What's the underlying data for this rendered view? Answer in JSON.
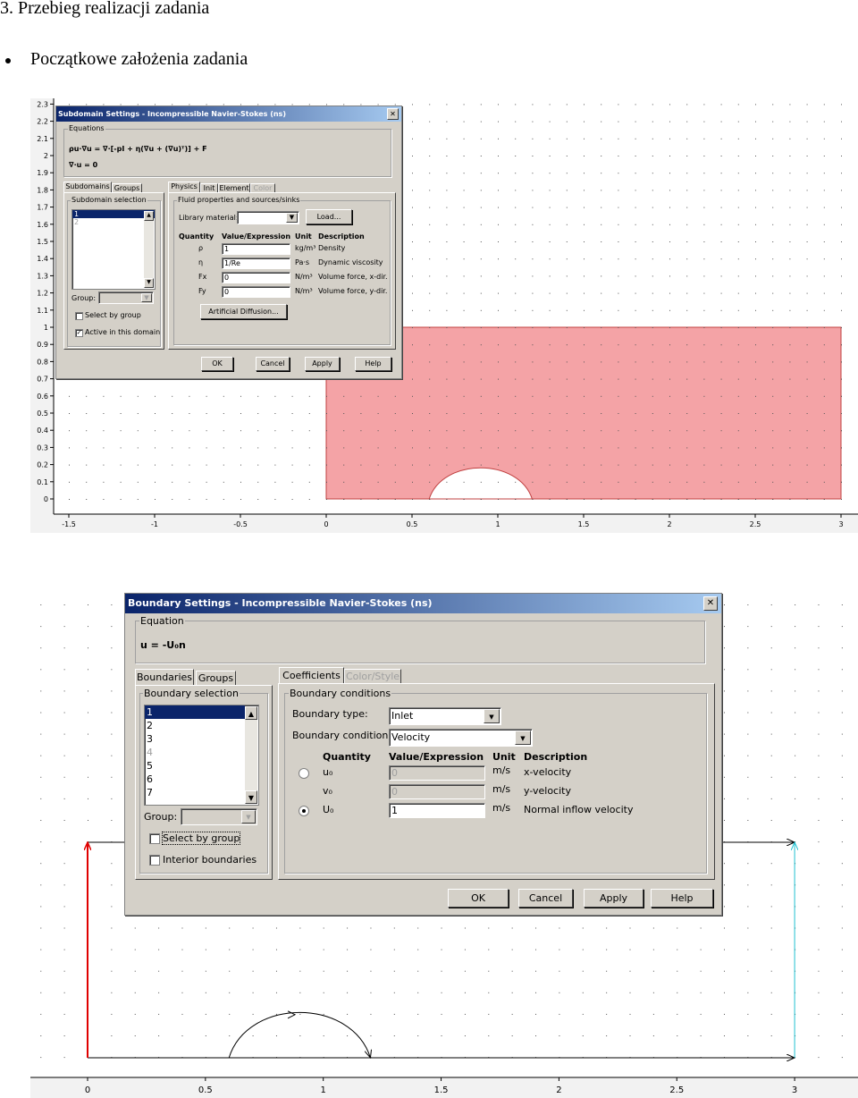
{
  "document": {
    "heading": "3.  Przebieg realizacji zadania",
    "bullet": "Początkowe założenia zadania"
  },
  "figure1": {
    "y_ticks": [
      "0",
      "0.1",
      "0.2",
      "0.3",
      "0.4",
      "0.5",
      "0.6",
      "0.7",
      "0.8",
      "0.9",
      "1",
      "1.1",
      "1.2",
      "1.3",
      "1.4",
      "1.5",
      "1.6",
      "1.7",
      "1.8",
      "1.9",
      "2",
      "2.1",
      "2.2",
      "2.3"
    ],
    "x_ticks": [
      "-1.5",
      "-1",
      "-0.5",
      "0",
      "0.5",
      "1",
      "1.5",
      "2",
      "2.5",
      "3"
    ],
    "domain_color": "#f4a3a6",
    "domain": {
      "x": [
        0,
        3
      ],
      "y": [
        0,
        1
      ]
    },
    "obstacle": {
      "x": [
        0.6,
        1.2
      ],
      "peak": 0.2
    }
  },
  "dialog1": {
    "title": "Subdomain Settings - Incompressible Navier-Stokes (ns)",
    "close": "✕",
    "equations_label": "Equations",
    "eq1": "ρu·∇u = ∇·[-pI + η(∇u + (∇u)ᵀ)] + F",
    "eq2": "∇·u = 0",
    "left_tabs": [
      "Subdomains",
      "Groups"
    ],
    "selection_label": "Subdomain selection",
    "items": [
      "1",
      "2"
    ],
    "group_label": "Group:",
    "select_by_group": "Select by group",
    "active_label": "Active in this domain",
    "right_tabs": [
      "Physics",
      "Init",
      "Element",
      "Color"
    ],
    "fluid_label": "Fluid properties and sources/sinks",
    "library_label": "Library material:",
    "load_button": "Load...",
    "headers": [
      "Quantity",
      "Value/Expression",
      "Unit",
      "Description"
    ],
    "rows": [
      {
        "q": "ρ",
        "v": "1",
        "u": "kg/m³",
        "d": "Density"
      },
      {
        "q": "η",
        "v": "1/Re",
        "u": "Pa·s",
        "d": "Dynamic viscosity"
      },
      {
        "q": "Fx",
        "v": "0",
        "u": "N/m³",
        "d": "Volume force, x-dir."
      },
      {
        "q": "Fy",
        "v": "0",
        "u": "N/m³",
        "d": "Volume force, y-dir."
      }
    ],
    "artificial_diffusion": "Artificial Diffusion...",
    "buttons": [
      "OK",
      "Cancel",
      "Apply",
      "Help"
    ]
  },
  "figure2": {
    "x_ticks": [
      "0",
      "0.5",
      "1",
      "1.5",
      "2",
      "2.5",
      "3"
    ],
    "inlet_color": "#e00000",
    "outlet_color": "#20c0d0"
  },
  "dialog2": {
    "title": "Boundary Settings - Incompressible Navier-Stokes (ns)",
    "close": "✕",
    "equation_label": "Equation",
    "equation": "u = -U₀n",
    "left_tabs": [
      "Boundaries",
      "Groups"
    ],
    "selection_label": "Boundary selection",
    "items": [
      "1",
      "2",
      "3",
      "4",
      "5",
      "6",
      "7"
    ],
    "group_label": "Group:",
    "select_by_group": "Select by group",
    "interior_label": "Interior boundaries",
    "right_tabs": [
      "Coefficients",
      "Color/Style"
    ],
    "bc_label": "Boundary conditions",
    "boundary_type_label": "Boundary type:",
    "boundary_type": "Inlet",
    "boundary_condition_label": "Boundary condition:",
    "boundary_condition": "Velocity",
    "headers": [
      "Quantity",
      "Value/Expression",
      "Unit",
      "Description"
    ],
    "rows": [
      {
        "q": "u₀",
        "v": "0",
        "u": "m/s",
        "d": "x-velocity"
      },
      {
        "q": "v₀",
        "v": "0",
        "u": "m/s",
        "d": "y-velocity"
      },
      {
        "q": "U₀",
        "v": "1",
        "u": "m/s",
        "d": "Normal inflow velocity"
      }
    ],
    "buttons": [
      "OK",
      "Cancel",
      "Apply",
      "Help"
    ]
  }
}
